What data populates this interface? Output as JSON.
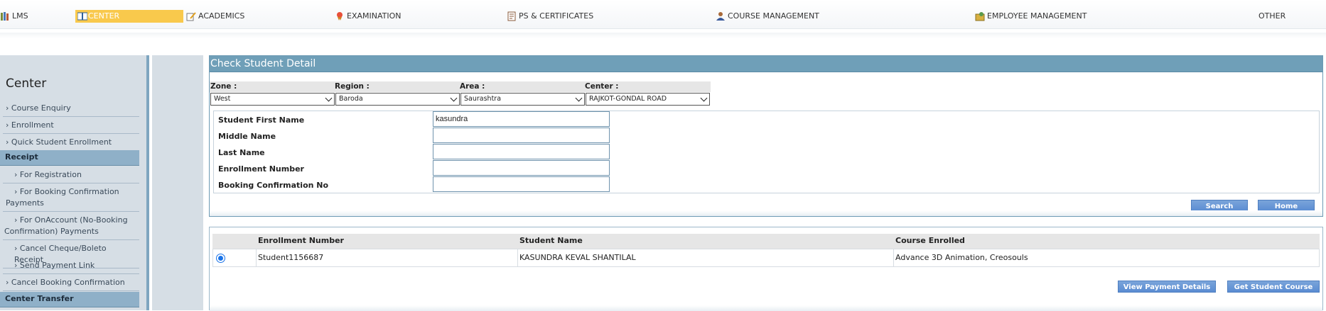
{
  "top_menu": {
    "items": [
      {
        "label": "LMS",
        "icon": "books-icon"
      },
      {
        "label": "CENTER",
        "icon": "book-open-icon"
      },
      {
        "label": "ACADEMICS",
        "icon": "pencil-icon"
      },
      {
        "label": "EXAMINATION",
        "icon": "award-icon"
      },
      {
        "label": "PS & CERTIFICATES",
        "icon": "certificate-icon"
      },
      {
        "label": "COURSE MANAGEMENT",
        "icon": "user-icon"
      },
      {
        "label": "EMPLOYEE MANAGEMENT",
        "icon": "employee-box-icon"
      },
      {
        "label": "OTHER",
        "icon": ""
      }
    ],
    "active": "CENTER"
  },
  "sidebar": {
    "title": "Center",
    "items": [
      {
        "label": "Course Enquiry",
        "type": "item"
      },
      {
        "label": "Enrollment",
        "type": "item"
      },
      {
        "label": "Quick Student Enrollment",
        "type": "item"
      },
      {
        "label": "Receipt",
        "type": "heading"
      },
      {
        "label": "For Registration",
        "type": "sub"
      },
      {
        "label": "For Booking Confirmation Payments",
        "type": "sub"
      },
      {
        "label": "For OnAccount (No-Booking Confirmation) Payments",
        "type": "sub"
      },
      {
        "label": "Cancel Cheque/Boleto Receipt",
        "type": "sub"
      },
      {
        "label": "Send Payment Link",
        "type": "sub"
      },
      {
        "label": "Cancel Booking Confirmation",
        "type": "item"
      },
      {
        "label": "Center Transfer",
        "type": "heading"
      }
    ]
  },
  "panel": {
    "title": "Check Student Detail",
    "filters": {
      "zone": {
        "label": "Zone :",
        "value": "West"
      },
      "region": {
        "label": "Region :",
        "value": "Baroda"
      },
      "area": {
        "label": "Area :",
        "value": "Saurashtra"
      },
      "center": {
        "label": "Center :",
        "value": "RAJKOT-GONDAL ROAD"
      }
    },
    "fields": {
      "first_name": {
        "label": "Student First Name",
        "value": "kasundra"
      },
      "middle_name": {
        "label": "Middle Name",
        "value": ""
      },
      "last_name": {
        "label": "Last Name",
        "value": ""
      },
      "enrollment_number": {
        "label": "Enrollment Number",
        "value": ""
      },
      "booking_no": {
        "label": "Booking Confirmation No",
        "value": ""
      }
    },
    "buttons": {
      "search": "Search",
      "home": "Home"
    }
  },
  "results": {
    "columns": [
      "Enrollment Number",
      "Student Name",
      "Course Enrolled"
    ],
    "rows": [
      {
        "enrollment": "Student1156687",
        "name": "KASUNDRA KEVAL SHANTILAL",
        "course": "Advance 3D Animation, Creosouls",
        "selected": true
      }
    ],
    "buttons": {
      "view_payment": "View Payment Details",
      "course_detail": "Get Student Course Detail"
    }
  },
  "colors": {
    "header_blue": "#6f9fb8",
    "active_tab": "#f9c94c",
    "button_blue": "#5a8cd2",
    "sidebar_bg": "#d6dee5"
  }
}
